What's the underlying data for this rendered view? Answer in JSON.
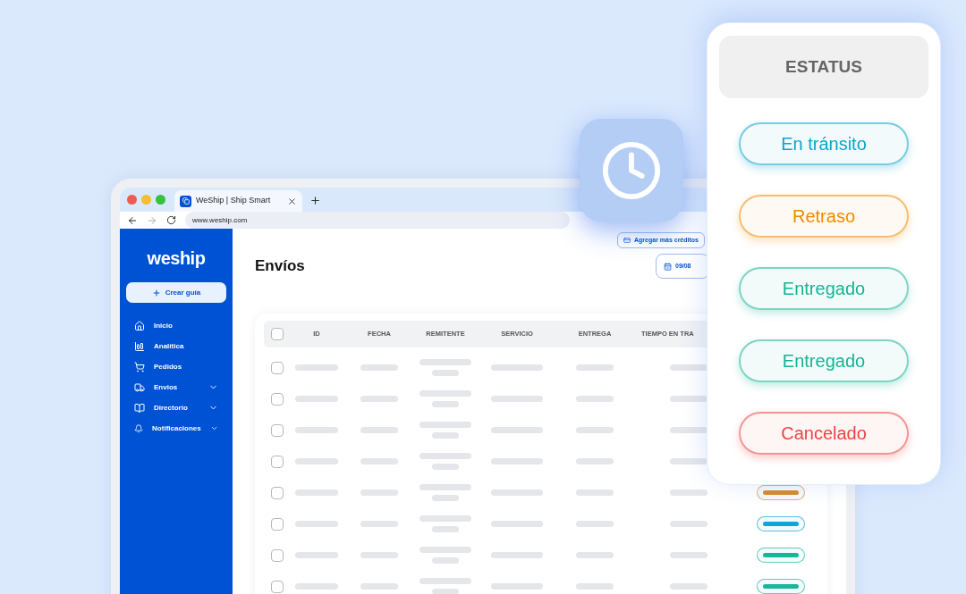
{
  "browser": {
    "tab_title": "WeShip | Ship Smart",
    "url": "www.weship.com"
  },
  "sidebar": {
    "logo": "weship",
    "create_button": "Crear guía",
    "items": [
      {
        "label": "Inicio",
        "expandable": false
      },
      {
        "label": "Analítica",
        "expandable": false
      },
      {
        "label": "Pedidos",
        "expandable": false
      },
      {
        "label": "Envios",
        "expandable": true
      },
      {
        "label": "Directorio",
        "expandable": true
      },
      {
        "label": "Notificaciones",
        "expandable": true
      }
    ]
  },
  "header": {
    "title": "Envíos",
    "credits_button": "Agregar más créditos",
    "date_button": "09/08"
  },
  "table": {
    "select_all_checked": false,
    "columns": [
      "ID",
      "FECHA",
      "REMITENTE",
      "SERVICIO",
      "ENTREGA",
      "TIEMPO EN TRA"
    ],
    "rows": [
      {
        "checked": false
      },
      {
        "checked": false
      },
      {
        "checked": false
      },
      {
        "checked": false
      },
      {
        "checked": false,
        "color": "#d98b2b"
      },
      {
        "checked": false,
        "color": "#0ea5d9"
      },
      {
        "checked": false,
        "color": "#14b898"
      },
      {
        "checked": false,
        "color": "#14b898"
      }
    ]
  },
  "status_card": {
    "title": "ESTATUS",
    "statuses": [
      {
        "label": "En tránsito",
        "color": "#0ba5cc"
      },
      {
        "label": "Retraso",
        "color": "#f08a00"
      },
      {
        "label": "Entregado",
        "color": "#16b394"
      },
      {
        "label": "Entregado",
        "color": "#16b394"
      },
      {
        "label": "Cancelado",
        "color": "#ef4444"
      }
    ]
  }
}
